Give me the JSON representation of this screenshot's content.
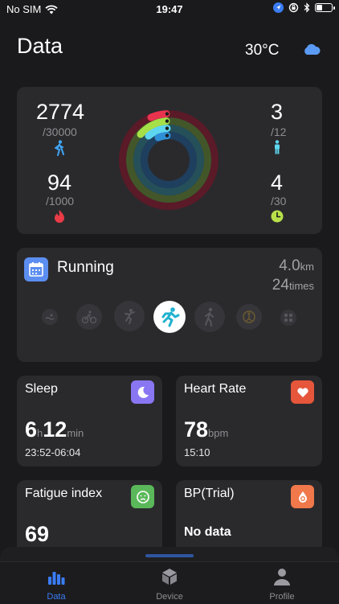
{
  "status_bar": {
    "carrier": "No SIM",
    "time": "19:47"
  },
  "header": {
    "title": "Data",
    "temperature": "30°C"
  },
  "summary": {
    "steps": {
      "value": "2774",
      "goal": "/30000"
    },
    "stand": {
      "value": "3",
      "goal": "/12"
    },
    "calories": {
      "value": "94",
      "goal": "/1000"
    },
    "exercise": {
      "value": "4",
      "goal": "/30"
    }
  },
  "running": {
    "title": "Running",
    "distance": "4.0",
    "distance_unit": "km",
    "count": "24",
    "count_unit": "times"
  },
  "sleep": {
    "title": "Sleep",
    "hours": "6",
    "hours_unit": "h",
    "minutes": "12",
    "minutes_unit": "min",
    "range": "23:52-06:04"
  },
  "heart_rate": {
    "title": "Heart Rate",
    "value": "78",
    "unit": "bpm",
    "time": "15:10"
  },
  "fatigue": {
    "title": "Fatigue index",
    "value": "69"
  },
  "bp": {
    "title": "BP(Trial)",
    "value": "No data"
  },
  "tabs": [
    {
      "label": "Data"
    },
    {
      "label": "Device"
    },
    {
      "label": "Profile"
    }
  ],
  "colors": {
    "accent": "#3a7cf5",
    "ring_outer": "#e8334f",
    "ring_second": "#a6e048",
    "ring_third": "#5ed6f0",
    "ring_inner": "#2f8fd6",
    "sleep_icon": "#8876f3",
    "heart_icon": "#e5563b",
    "fatigue_icon": "#5bb85a",
    "bp_icon": "#f0784a"
  }
}
